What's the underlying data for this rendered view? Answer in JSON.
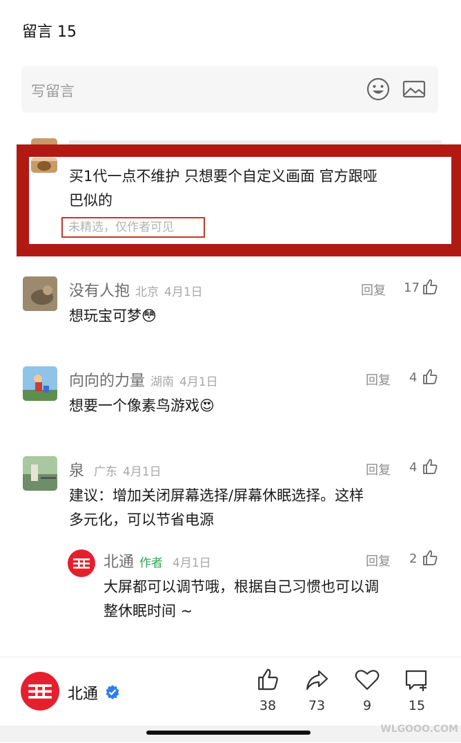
{
  "header": {
    "title": "留言 15"
  },
  "compose": {
    "placeholder": "写留言",
    "emoji_icon": "smiley-icon",
    "image_icon": "image-icon"
  },
  "highlighted_comment": {
    "text_line1": "买1代一点不维护 只想要个自定义画面 官方跟哑",
    "text_line2": "巴似的",
    "hint": "未精选，仅作者可见"
  },
  "comments": [
    {
      "name": "没有人抱",
      "location": "北京",
      "date": "4月1日",
      "reply": "回复",
      "likes": "17",
      "text": "想玩宝可梦😳"
    },
    {
      "name": "向向的力量",
      "location": "湖南",
      "date": "4月1日",
      "reply": "回复",
      "likes": "4",
      "text": "想要一个像素鸟游戏😍"
    },
    {
      "name": "泉",
      "location": "广东",
      "date": "4月1日",
      "reply": "回复",
      "likes": "4",
      "text_line1": "建议：增加关闭屏幕选择/屏幕休眠选择。这样",
      "text_line2": "多元化，可以节省电源"
    }
  ],
  "author_reply": {
    "name": "北通",
    "tag": "作者",
    "date": "4月1日",
    "reply": "回复",
    "likes": "2",
    "text_line1": "大屏都可以调节哦，根据自己习惯也可以调",
    "text_line2": "整休眠时间 ~"
  },
  "bottom": {
    "account": "北通",
    "like_count": "38",
    "share_count": "73",
    "fav_count": "9",
    "comment_count": "15"
  },
  "colors": {
    "brand_red": "#e5202e",
    "frame_red": "#b01a12",
    "author_green": "#2fa853"
  },
  "watermark": "WLGOOO.COM"
}
